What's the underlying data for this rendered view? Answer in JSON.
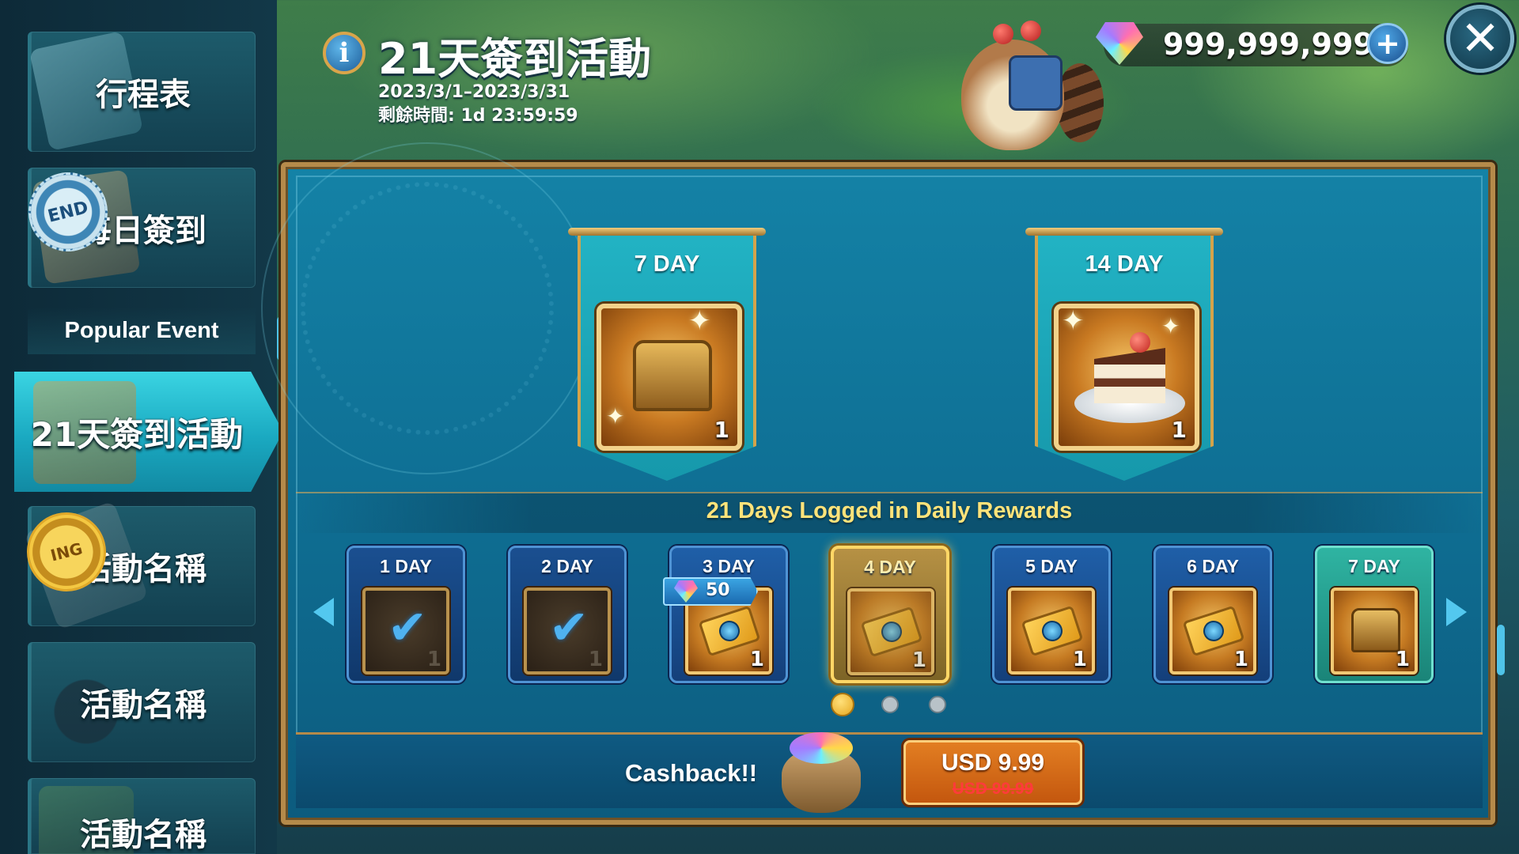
{
  "header": {
    "info_icon": "info-icon",
    "title": "21天簽到活動",
    "date_range": "2023/3/1–2023/3/31",
    "remaining": "剩餘時間: 1d 23:59:59"
  },
  "currency": {
    "icon": "gem-icon",
    "amount": "999,999,999",
    "add_icon": "plus-icon"
  },
  "close_icon": "close-icon",
  "sidebar": {
    "items": [
      {
        "label": "行程表",
        "icon": "clipboard-icon"
      },
      {
        "label": "每日簽到",
        "icon": "calendar-icon",
        "stamp": "END"
      },
      {
        "label": "21天簽到活動",
        "icon": "gift-icon",
        "active": true
      },
      {
        "label": "活動名稱",
        "icon": "bow-icon",
        "stamp": "ING"
      },
      {
        "label": "活動名稱",
        "icon": "hat-icon"
      },
      {
        "label": "活動名稱",
        "icon": "tree-icon"
      }
    ],
    "section_header": "Popular Event"
  },
  "milestones": [
    {
      "label": "7 DAY",
      "reward": "treasure-chest",
      "qty": "1"
    },
    {
      "label": "14 DAY",
      "reward": "cake",
      "qty": "1"
    }
  ],
  "daily": {
    "title": "21 Days Logged in Daily Rewards",
    "days": [
      {
        "label": "1 DAY",
        "state": "claimed",
        "reward": "check",
        "qty": "1"
      },
      {
        "label": "2 DAY",
        "state": "claimed",
        "reward": "check",
        "qty": "1"
      },
      {
        "label": "3 DAY",
        "state": "locked",
        "reward": "ticket",
        "qty": "1",
        "bonus": "50"
      },
      {
        "label": "4 DAY",
        "state": "today",
        "reward": "ticket",
        "qty": "1"
      },
      {
        "label": "5 DAY",
        "state": "locked",
        "reward": "ticket",
        "qty": "1"
      },
      {
        "label": "6 DAY",
        "state": "locked",
        "reward": "ticket",
        "qty": "1"
      },
      {
        "label": "7 DAY",
        "state": "special",
        "reward": "treasure-chest",
        "qty": "1"
      }
    ],
    "page_count": 3,
    "current_page": 1
  },
  "offer": {
    "label": "Cashback!!",
    "price": "USD 9.99",
    "original_price": "USD 99.99"
  },
  "colors": {
    "accent_cyan": "#1aa9c1",
    "gold": "#b58a4a",
    "title_yellow": "#ffe37a",
    "buy_orange": "#c4570e",
    "strike_red": "#ff3b3b"
  }
}
